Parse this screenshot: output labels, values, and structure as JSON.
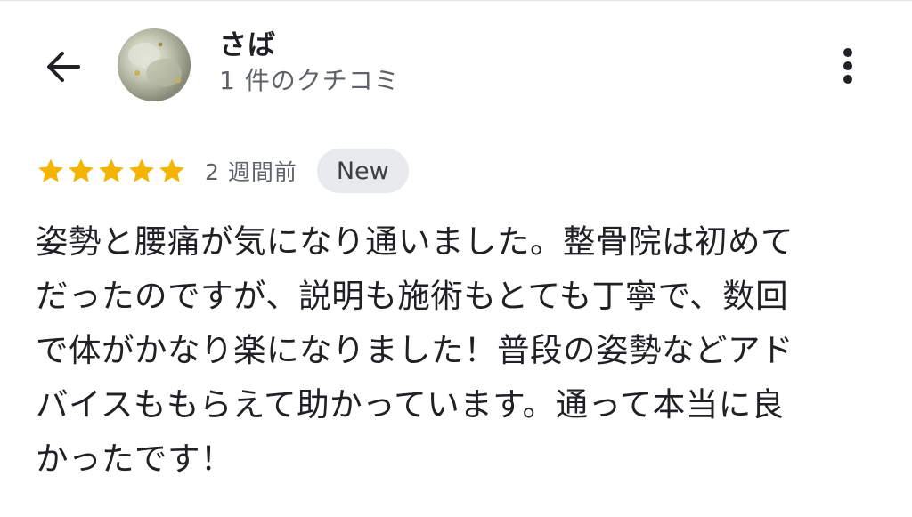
{
  "header": {
    "reviewer_name": "さば",
    "review_count": "1 件のクチコミ",
    "back_icon": "arrow-back-icon",
    "more_icon": "more-vert-icon"
  },
  "review": {
    "rating": 5,
    "max_rating": 5,
    "star_color": "#F4B400",
    "time_ago": "2 週間前",
    "badge": "New",
    "body_lines": [
      "姿勢と腰痛が気になり通いました。整骨院は初めて",
      "だったのですが、説明も施術もとても丁寧で、数回",
      "で体がかなり楽になりました！普段の姿勢などアド",
      "バイスももらえて助かっています。通って本当に良",
      "かったです！"
    ]
  }
}
